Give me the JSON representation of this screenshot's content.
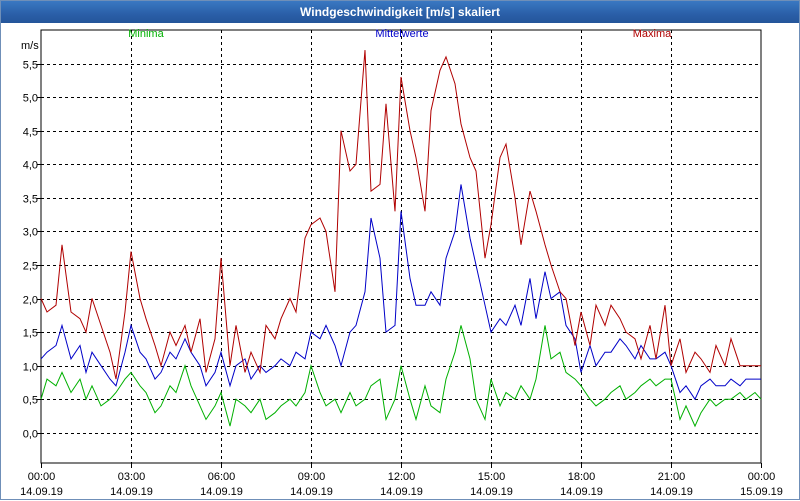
{
  "window": {
    "title": "Windgeschwindigkeit [m/s] skaliert"
  },
  "chart_data": {
    "type": "line",
    "title": "Windgeschwindigkeit [m/s] skaliert",
    "ylabel": "m/s",
    "ylim": [
      -0.45,
      6.0
    ],
    "y_ticks": [
      "0,0",
      "0,5",
      "1,0",
      "1,5",
      "2,0",
      "2,5",
      "3,0",
      "3,5",
      "4,0",
      "4,5",
      "5,0",
      "5,5"
    ],
    "y_tick_values": [
      0,
      0.5,
      1.0,
      1.5,
      2.0,
      2.5,
      3.0,
      3.5,
      4.0,
      4.5,
      5.0,
      5.5
    ],
    "x_range_hours": [
      0,
      24
    ],
    "x_ticks": [
      {
        "time": "00:00",
        "date": "14.09.19"
      },
      {
        "time": "03:00",
        "date": "14.09.19"
      },
      {
        "time": "06:00",
        "date": "14.09.19"
      },
      {
        "time": "09:00",
        "date": "14.09.19"
      },
      {
        "time": "12:00",
        "date": "14.09.19"
      },
      {
        "time": "15:00",
        "date": "14.09.19"
      },
      {
        "time": "18:00",
        "date": "14.09.19"
      },
      {
        "time": "21:00",
        "date": "14.09.19"
      },
      {
        "time": "00:00",
        "date": "15.09.19"
      }
    ],
    "grid": true,
    "legend_placement": "top",
    "series": [
      {
        "name": "Minima",
        "color": "#00b000",
        "x": [
          0.0,
          0.2,
          0.5,
          0.7,
          1.0,
          1.3,
          1.5,
          1.7,
          2.0,
          2.3,
          2.5,
          2.8,
          3.0,
          3.3,
          3.5,
          3.8,
          4.0,
          4.3,
          4.5,
          4.8,
          5.0,
          5.3,
          5.5,
          5.8,
          6.0,
          6.3,
          6.5,
          6.8,
          7.0,
          7.3,
          7.5,
          7.8,
          8.0,
          8.3,
          8.5,
          8.8,
          9.0,
          9.3,
          9.5,
          9.8,
          10.0,
          10.3,
          10.5,
          10.8,
          11.0,
          11.3,
          11.5,
          11.8,
          12.0,
          12.3,
          12.5,
          12.8,
          13.0,
          13.3,
          13.5,
          13.8,
          14.0,
          14.3,
          14.5,
          14.8,
          15.0,
          15.3,
          15.5,
          15.8,
          16.0,
          16.3,
          16.5,
          16.8,
          17.0,
          17.3,
          17.5,
          17.8,
          18.0,
          18.3,
          18.5,
          18.8,
          19.0,
          19.3,
          19.5,
          19.8,
          20.0,
          20.3,
          20.5,
          20.8,
          21.0,
          21.3,
          21.5,
          21.8,
          22.0,
          22.3,
          22.5,
          22.8,
          23.0,
          23.3,
          23.5,
          23.8,
          24.0
        ],
        "values": [
          0.5,
          0.8,
          0.7,
          0.9,
          0.6,
          0.8,
          0.5,
          0.7,
          0.4,
          0.5,
          0.6,
          0.8,
          0.9,
          0.7,
          0.6,
          0.3,
          0.4,
          0.7,
          0.6,
          1.0,
          0.7,
          0.4,
          0.2,
          0.4,
          0.6,
          0.1,
          0.5,
          0.4,
          0.3,
          0.5,
          0.2,
          0.3,
          0.4,
          0.5,
          0.4,
          0.6,
          1.0,
          0.6,
          0.4,
          0.5,
          0.3,
          0.6,
          0.4,
          0.5,
          0.7,
          0.8,
          0.2,
          0.5,
          1.0,
          0.5,
          0.2,
          0.7,
          0.4,
          0.3,
          0.8,
          1.2,
          1.6,
          1.1,
          0.5,
          0.2,
          0.8,
          0.4,
          0.6,
          0.5,
          0.7,
          0.5,
          0.8,
          1.6,
          1.1,
          1.2,
          0.9,
          0.8,
          0.7,
          0.5,
          0.4,
          0.5,
          0.6,
          0.7,
          0.5,
          0.6,
          0.7,
          0.8,
          0.7,
          0.8,
          0.8,
          0.2,
          0.4,
          0.1,
          0.3,
          0.5,
          0.4,
          0.5,
          0.5,
          0.6,
          0.5,
          0.6,
          0.5
        ]
      },
      {
        "name": "Mittelwerte",
        "color": "#0000c8",
        "x": [
          0.0,
          0.2,
          0.5,
          0.7,
          1.0,
          1.3,
          1.5,
          1.7,
          2.0,
          2.3,
          2.5,
          2.8,
          3.0,
          3.3,
          3.5,
          3.8,
          4.0,
          4.3,
          4.5,
          4.8,
          5.0,
          5.3,
          5.5,
          5.8,
          6.0,
          6.3,
          6.5,
          6.8,
          7.0,
          7.3,
          7.5,
          7.8,
          8.0,
          8.3,
          8.5,
          8.8,
          9.0,
          9.3,
          9.5,
          9.8,
          10.0,
          10.3,
          10.5,
          10.8,
          11.0,
          11.3,
          11.5,
          11.8,
          12.0,
          12.3,
          12.5,
          12.8,
          13.0,
          13.3,
          13.5,
          13.8,
          14.0,
          14.3,
          14.5,
          14.8,
          15.0,
          15.3,
          15.5,
          15.8,
          16.0,
          16.3,
          16.5,
          16.8,
          17.0,
          17.3,
          17.5,
          17.8,
          18.0,
          18.3,
          18.5,
          18.8,
          19.0,
          19.3,
          19.5,
          19.8,
          20.0,
          20.3,
          20.5,
          20.8,
          21.0,
          21.3,
          21.5,
          21.8,
          22.0,
          22.3,
          22.5,
          22.8,
          23.0,
          23.3,
          23.5,
          23.8,
          24.0
        ],
        "values": [
          1.1,
          1.2,
          1.3,
          1.6,
          1.1,
          1.3,
          0.9,
          1.2,
          1.0,
          0.8,
          0.7,
          1.2,
          1.6,
          1.2,
          1.1,
          0.8,
          0.9,
          1.2,
          1.1,
          1.4,
          1.2,
          1.0,
          0.7,
          0.9,
          1.2,
          0.7,
          1.0,
          1.1,
          0.8,
          1.0,
          0.9,
          1.0,
          1.1,
          1.0,
          1.2,
          1.1,
          1.5,
          1.4,
          1.6,
          1.3,
          1.0,
          1.5,
          1.6,
          2.1,
          3.2,
          2.6,
          1.5,
          1.6,
          3.3,
          2.3,
          1.9,
          1.9,
          2.1,
          1.9,
          2.6,
          3.0,
          3.7,
          2.9,
          2.5,
          1.9,
          1.5,
          1.7,
          1.6,
          1.9,
          1.6,
          2.3,
          1.7,
          2.4,
          2.0,
          2.1,
          1.6,
          1.4,
          0.9,
          1.3,
          1.0,
          1.2,
          1.2,
          1.4,
          1.3,
          1.1,
          1.3,
          1.1,
          1.1,
          1.2,
          1.0,
          0.6,
          0.7,
          0.5,
          0.7,
          0.8,
          0.7,
          0.7,
          0.8,
          0.7,
          0.8,
          0.8,
          0.8
        ]
      },
      {
        "name": "Maxima",
        "color": "#b00000",
        "x": [
          0.0,
          0.2,
          0.5,
          0.7,
          1.0,
          1.3,
          1.5,
          1.7,
          2.0,
          2.3,
          2.5,
          2.8,
          3.0,
          3.3,
          3.5,
          3.8,
          4.0,
          4.3,
          4.5,
          4.8,
          5.0,
          5.3,
          5.5,
          5.8,
          6.0,
          6.3,
          6.5,
          6.8,
          7.0,
          7.3,
          7.5,
          7.8,
          8.0,
          8.3,
          8.5,
          8.8,
          9.0,
          9.3,
          9.5,
          9.8,
          10.0,
          10.3,
          10.5,
          10.8,
          11.0,
          11.3,
          11.5,
          11.8,
          12.0,
          12.3,
          12.5,
          12.8,
          13.0,
          13.3,
          13.5,
          13.8,
          14.0,
          14.3,
          14.5,
          14.8,
          15.0,
          15.3,
          15.5,
          15.8,
          16.0,
          16.3,
          16.5,
          16.8,
          17.0,
          17.3,
          17.5,
          17.8,
          18.0,
          18.3,
          18.5,
          18.8,
          19.0,
          19.3,
          19.5,
          19.8,
          20.0,
          20.3,
          20.5,
          20.8,
          21.0,
          21.3,
          21.5,
          21.8,
          22.0,
          22.3,
          22.5,
          22.8,
          23.0,
          23.3,
          23.5,
          23.8,
          24.0
        ],
        "values": [
          2.0,
          1.8,
          1.9,
          2.8,
          1.8,
          1.7,
          1.5,
          2.0,
          1.6,
          1.2,
          0.8,
          1.8,
          2.7,
          2.0,
          1.7,
          1.3,
          1.0,
          1.5,
          1.3,
          1.6,
          1.2,
          1.7,
          0.9,
          1.4,
          2.6,
          1.0,
          1.6,
          0.9,
          1.2,
          0.9,
          1.6,
          1.4,
          1.7,
          2.0,
          1.8,
          2.9,
          3.1,
          3.2,
          3.0,
          2.1,
          4.5,
          3.9,
          4.0,
          5.7,
          3.6,
          3.7,
          4.9,
          3.3,
          5.3,
          4.5,
          4.1,
          3.3,
          4.8,
          5.4,
          5.6,
          5.2,
          4.6,
          4.1,
          3.9,
          2.6,
          3.1,
          4.1,
          4.3,
          3.5,
          2.8,
          3.6,
          3.3,
          2.8,
          2.5,
          2.1,
          2.0,
          1.3,
          1.8,
          1.3,
          1.9,
          1.6,
          1.9,
          1.7,
          1.5,
          1.4,
          1.1,
          1.6,
          1.1,
          1.9,
          1.0,
          1.4,
          0.9,
          1.2,
          1.1,
          0.9,
          1.3,
          1.0,
          1.4,
          1.0,
          1.0,
          1.0,
          1.0
        ]
      }
    ]
  }
}
